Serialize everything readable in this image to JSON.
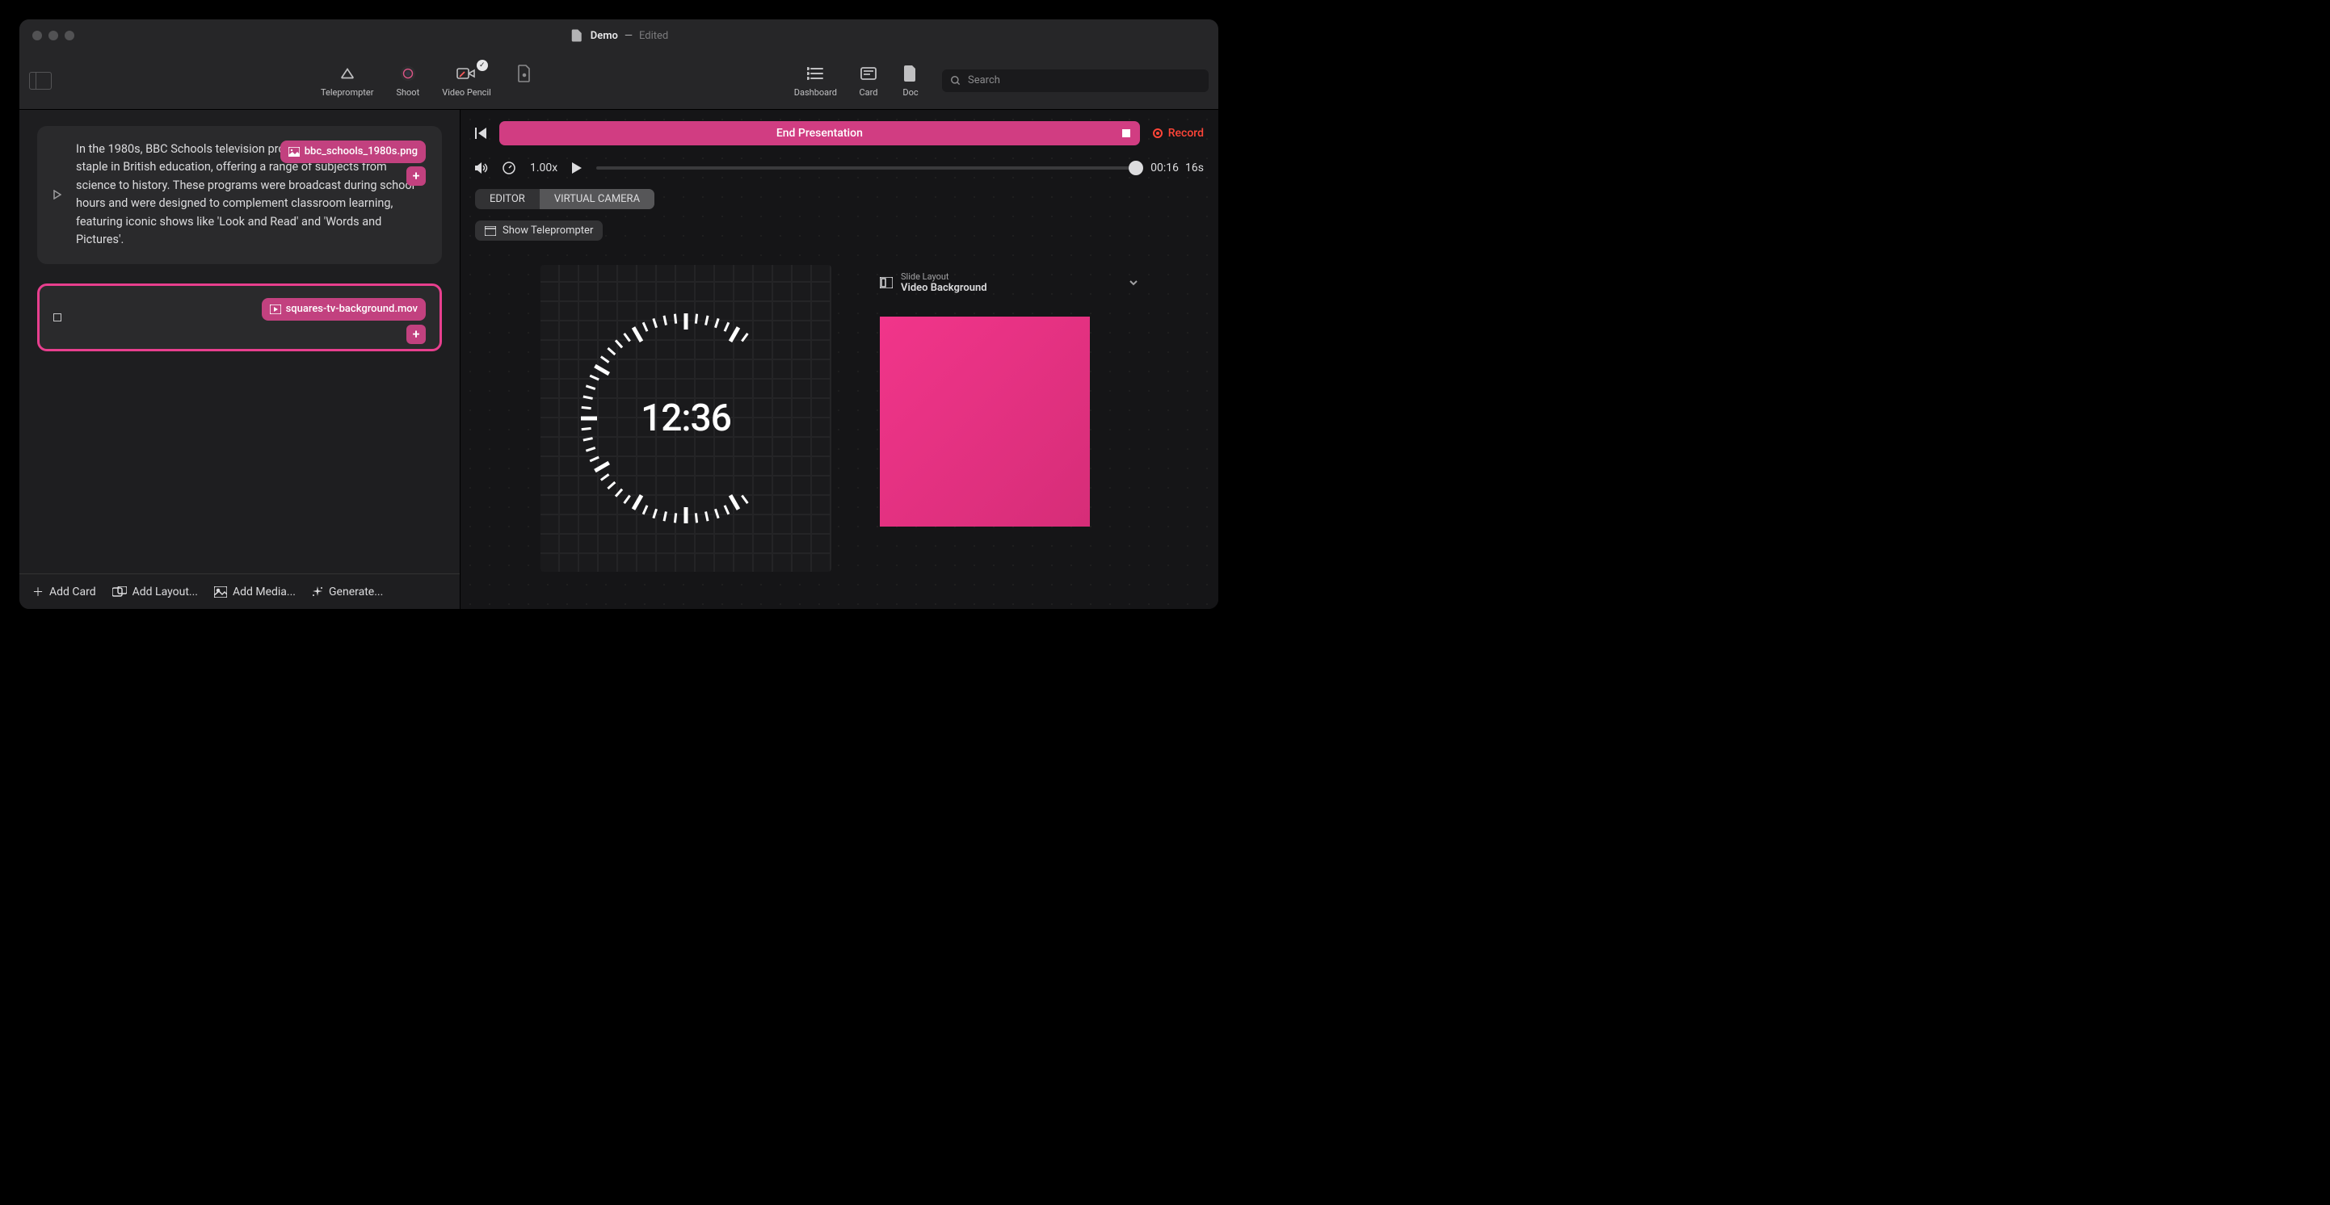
{
  "titlebar": {
    "doc_name": "Demo",
    "edited": "Edited"
  },
  "toolbar": {
    "teleprompter": "Teleprompter",
    "shoot": "Shoot",
    "video_pencil": "Video Pencil",
    "dashboard": "Dashboard",
    "card": "Card",
    "doc": "Doc",
    "search_placeholder": "Search"
  },
  "sidebar": {
    "cards": [
      {
        "text": "In the 1980s, BBC Schools television programming became a staple in British education, offering a range of subjects from science to history. These programs were broadcast during school hours and were designed to complement classroom learning, featuring iconic shows like 'Look and Read' and 'Words and Pictures'.",
        "attachment": "bbc_schools_1980s.png"
      },
      {
        "text": "",
        "attachment": "squares-tv-background.mov"
      }
    ],
    "footer": {
      "add_card": "Add Card",
      "add_layout": "Add Layout...",
      "add_media": "Add Media...",
      "generate": "Generate..."
    }
  },
  "presentation": {
    "end_label": "End Presentation",
    "record_label": "Record",
    "speed": "1.00x",
    "time_elapsed": "00:16",
    "time_total": "16s",
    "tabs": {
      "editor": "EDITOR",
      "virtual_camera": "VIRTUAL CAMERA"
    },
    "show_teleprompter": "Show Teleprompter",
    "clock_time": "12:36",
    "slide_layout_label": "Slide Layout",
    "slide_layout_value": "Video Background"
  }
}
